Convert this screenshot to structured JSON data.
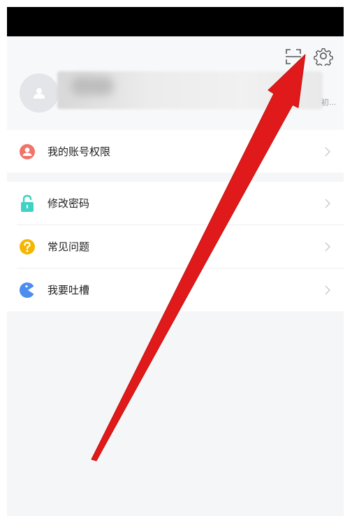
{
  "header": {
    "icons": [
      "scan-icon",
      "gear-icon"
    ],
    "tagline": "初..."
  },
  "menu": {
    "section1": [
      {
        "label": "我的账号权限",
        "icon": "account-permission-icon",
        "color": "#f07468"
      }
    ],
    "section2": [
      {
        "label": "修改密码",
        "icon": "lock-icon",
        "color": "#3fd2c5"
      },
      {
        "label": "常见问题",
        "icon": "question-icon",
        "color": "#f4b700"
      },
      {
        "label": "我要吐槽",
        "icon": "feedback-icon",
        "color": "#4d8df0"
      }
    ]
  },
  "annotation": {
    "arrow_color": "#e01a1a"
  }
}
